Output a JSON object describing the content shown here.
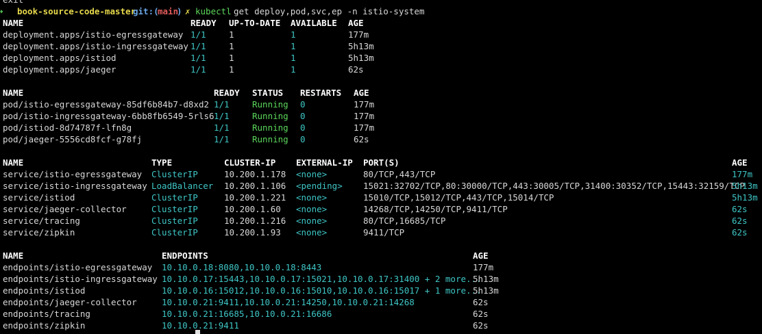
{
  "prev_line": "exit",
  "prompt": {
    "arrow": "➜",
    "dir": "book-source-code-master",
    "git_prefix": "git:(",
    "branch": "main",
    "git_suffix": ")",
    "dirty": "✗",
    "cmd": "kubectl",
    "args": "get deploy,pod,svc,ep -n istio-system"
  },
  "deployments": {
    "headers": [
      "NAME",
      "READY",
      "UP-TO-DATE",
      "AVAILABLE",
      "AGE"
    ],
    "rows": [
      [
        "deployment.apps/istio-egressgateway",
        "1/1",
        "1",
        "1",
        "177m"
      ],
      [
        "deployment.apps/istio-ingressgateway",
        "1/1",
        "1",
        "1",
        "5h13m"
      ],
      [
        "deployment.apps/istiod",
        "1/1",
        "1",
        "1",
        "5h13m"
      ],
      [
        "deployment.apps/jaeger",
        "1/1",
        "1",
        "1",
        "62s"
      ]
    ]
  },
  "pods": {
    "headers": [
      "NAME",
      "READY",
      "STATUS",
      "RESTARTS",
      "AGE"
    ],
    "rows": [
      [
        "pod/istio-egressgateway-85df6b84b7-d8xd2",
        "1/1",
        "Running",
        "0",
        "177m"
      ],
      [
        "pod/istio-ingressgateway-6bb8fb6549-5rls6",
        "1/1",
        "Running",
        "0",
        "177m"
      ],
      [
        "pod/istiod-8d74787f-lfn8g",
        "1/1",
        "Running",
        "0",
        "177m"
      ],
      [
        "pod/jaeger-5556cd8fcf-g78fj",
        "1/1",
        "Running",
        "0",
        "62s"
      ]
    ]
  },
  "services": {
    "headers": [
      "NAME",
      "TYPE",
      "CLUSTER-IP",
      "EXTERNAL-IP",
      "PORT(S)",
      "AGE"
    ],
    "rows": [
      [
        "service/istio-egressgateway",
        "ClusterIP",
        "10.200.1.178",
        "<none>",
        "80/TCP,443/TCP",
        "177m"
      ],
      [
        "service/istio-ingressgateway",
        "LoadBalancer",
        "10.200.1.106",
        "<pending>",
        "15021:32702/TCP,80:30000/TCP,443:30005/TCP,31400:30352/TCP,15443:32159/TCP",
        "5h13m"
      ],
      [
        "service/istiod",
        "ClusterIP",
        "10.200.1.221",
        "<none>",
        "15010/TCP,15012/TCP,443/TCP,15014/TCP",
        "5h13m"
      ],
      [
        "service/jaeger-collector",
        "ClusterIP",
        "10.200.1.60",
        "<none>",
        "14268/TCP,14250/TCP,9411/TCP",
        "62s"
      ],
      [
        "service/tracing",
        "ClusterIP",
        "10.200.1.216",
        "<none>",
        "80/TCP,16685/TCP",
        "62s"
      ],
      [
        "service/zipkin",
        "ClusterIP",
        "10.200.1.93",
        "<none>",
        "9411/TCP",
        "62s"
      ]
    ]
  },
  "endpoints": {
    "headers": [
      "NAME",
      "ENDPOINTS",
      "AGE"
    ],
    "rows": [
      [
        "endpoints/istio-egressgateway",
        "10.10.0.18:8080,10.10.0.18:8443",
        "177m"
      ],
      [
        "endpoints/istio-ingressgateway",
        "10.10.0.17:15443,10.10.0.17:15021,10.10.0.17:31400 + 2 more...",
        "5h13m"
      ],
      [
        "endpoints/istiod",
        "10.10.0.16:15012,10.10.0.16:15010,10.10.0.16:15017 + 1 more...",
        "5h13m"
      ],
      [
        "endpoints/jaeger-collector",
        "10.10.0.21:9411,10.10.0.21:14250,10.10.0.21:14268",
        "62s"
      ],
      [
        "endpoints/tracing",
        "10.10.0.21:16685,10.10.0.21:16686",
        "62s"
      ],
      [
        "endpoints/zipkin",
        "10.10.0.21:9411",
        "62s"
      ]
    ]
  },
  "colors": {
    "background": "#000000",
    "cyan": "#3fc6c6",
    "green": "#5cd75c",
    "prompt_yellow": "#e6d84a",
    "branch_red": "#e05a5a"
  }
}
